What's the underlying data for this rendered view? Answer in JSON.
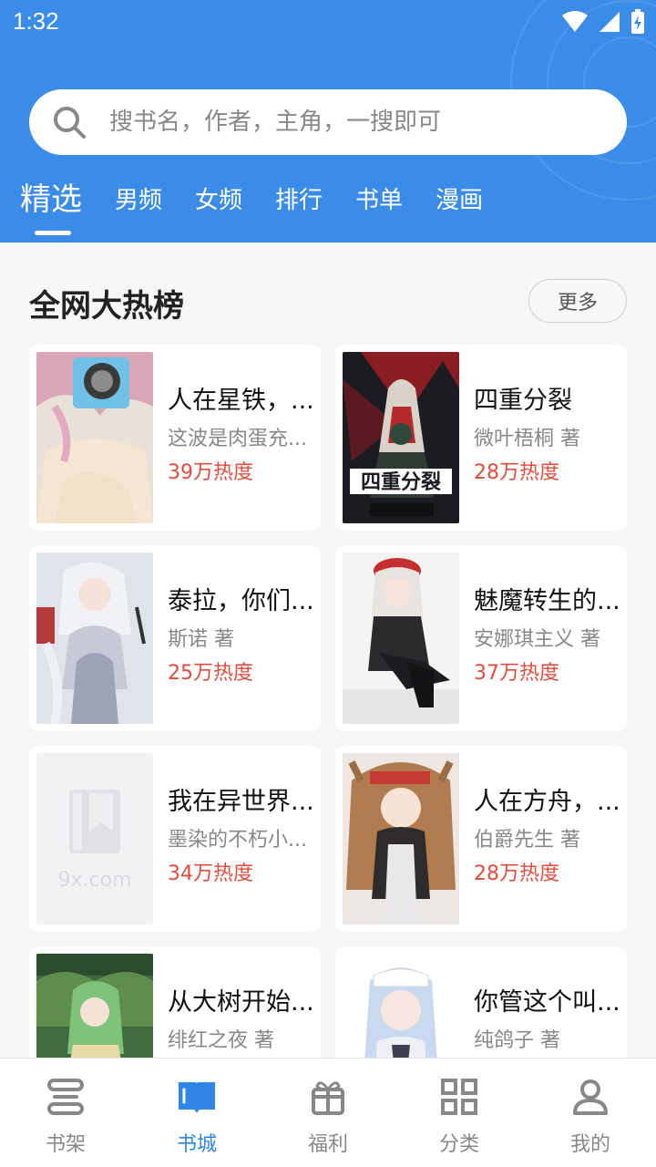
{
  "status_bar": {
    "time": "1:32"
  },
  "search": {
    "placeholder": "搜书名，作者，主角，一搜即可"
  },
  "tabs": [
    {
      "label": "精选",
      "active": true
    },
    {
      "label": "男频"
    },
    {
      "label": "女频"
    },
    {
      "label": "排行"
    },
    {
      "label": "书单"
    },
    {
      "label": "漫画"
    }
  ],
  "section": {
    "title": "全网大热榜",
    "more_label": "更多"
  },
  "books": [
    {
      "title": "人在星铁，...",
      "author": "这波是肉蛋充...",
      "hot": "39万热度",
      "cover": "anime-girl-camera"
    },
    {
      "title": "四重分裂",
      "author": "微叶梧桐 著",
      "hot": "28万热度",
      "cover": "four-split-cover"
    },
    {
      "title": "泰拉，你们...",
      "author": "斯诺 著",
      "hot": "25万热度",
      "cover": "white-hair-girl"
    },
    {
      "title": "魅魔转生的...",
      "author": "安娜琪主义 著",
      "hot": "37万热度",
      "cover": "red-beret-girl"
    },
    {
      "title": "我在异世界...",
      "author": "墨染的不朽小...",
      "hot": "34万热度",
      "cover": "placeholder-9x"
    },
    {
      "title": "人在方舟，...",
      "author": "伯爵先生 著",
      "hot": "28万热度",
      "cover": "brown-hair-girl"
    },
    {
      "title": "从大树开始...",
      "author": "绯红之夜 著",
      "hot": "",
      "cover": "green-hair-girl"
    },
    {
      "title": "你管这个叫...",
      "author": "纯鸽子 著",
      "hot": "",
      "cover": "blue-white-girl"
    }
  ],
  "bottom_nav": [
    {
      "label": "书架",
      "icon": "bookshelf-icon"
    },
    {
      "label": "书城",
      "icon": "open-book-icon",
      "active": true
    },
    {
      "label": "福利",
      "icon": "gift-icon"
    },
    {
      "label": "分类",
      "icon": "grid-icon"
    },
    {
      "label": "我的",
      "icon": "user-icon"
    }
  ],
  "colors": {
    "header": "#3b8ce8",
    "accent": "#2f86e6",
    "hot": "#e64a3c"
  },
  "watermark": "9x.com"
}
